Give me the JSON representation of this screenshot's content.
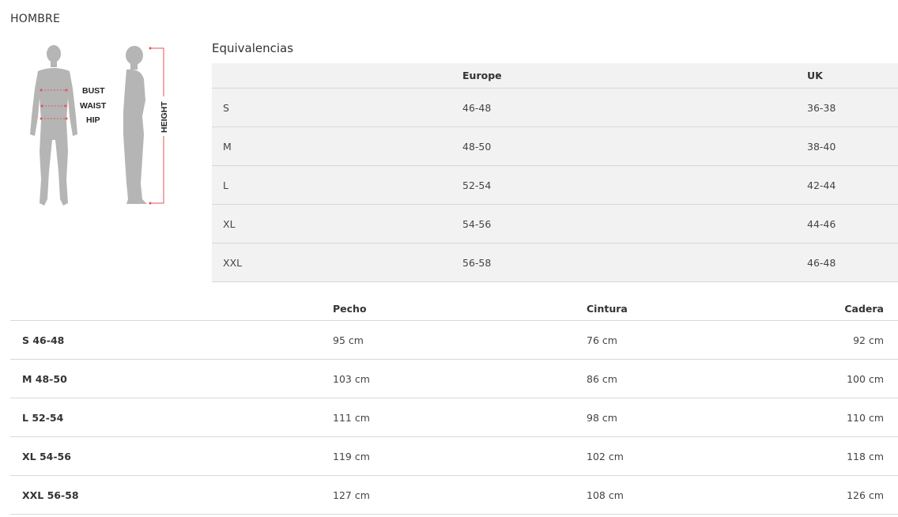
{
  "section_title": "HOMBRE",
  "figure": {
    "labels": {
      "bust": "BUST",
      "waist": "WAIST",
      "hip": "HIP",
      "height": "HEIGHT"
    },
    "silhouette_color": "#b5b5b5",
    "marker_color": "#e0574f"
  },
  "equivalencias": {
    "title": "Equivalencias",
    "headers": [
      "",
      "Europe",
      "UK"
    ],
    "rows": [
      [
        "S",
        "46-48",
        "36-38"
      ],
      [
        "M",
        "48-50",
        "38-40"
      ],
      [
        "L",
        "52-54",
        "42-44"
      ],
      [
        "XL",
        "54-56",
        "44-46"
      ],
      [
        "XXL",
        "56-58",
        "46-48"
      ]
    ]
  },
  "measurements": {
    "headers": [
      "",
      "Pecho",
      "Cintura",
      "Cadera"
    ],
    "rows": [
      [
        "S 46-48",
        "95 cm",
        "76 cm",
        "92 cm"
      ],
      [
        "M 48-50",
        "103 cm",
        "86 cm",
        "100 cm"
      ],
      [
        "L 52-54",
        "111 cm",
        "98 cm",
        "110 cm"
      ],
      [
        "XL 54-56",
        "119 cm",
        "102 cm",
        "118 cm"
      ],
      [
        "XXL 56-58",
        "127 cm",
        "108 cm",
        "126 cm"
      ]
    ]
  }
}
